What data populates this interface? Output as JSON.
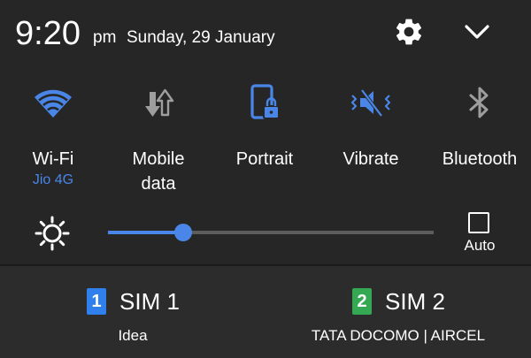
{
  "status": {
    "time": "9:20",
    "ampm": "pm",
    "date": "Sunday, 29 January"
  },
  "header_icons": {
    "settings": "gear-icon",
    "expand": "chevron-down-icon"
  },
  "tiles": [
    {
      "label": "Wi-Fi",
      "sublabel": "Jio 4G",
      "icon": "wifi-icon",
      "active": true
    },
    {
      "label": "Mobile\ndata",
      "icon": "mobile-data-icon",
      "active": false
    },
    {
      "label": "Portrait",
      "icon": "portrait-lock-icon",
      "active": true
    },
    {
      "label": "Vibrate",
      "icon": "vibrate-icon",
      "active": true
    },
    {
      "label": "Bluetooth",
      "icon": "bluetooth-icon",
      "active": false
    }
  ],
  "brightness": {
    "level": 0.23,
    "auto_label": "Auto",
    "auto_checked": false,
    "icon": "brightness-icon"
  },
  "sims": [
    {
      "badge": "1",
      "name": "SIM 1",
      "carrier": "Idea",
      "color": "#2f80ed"
    },
    {
      "badge": "2",
      "name": "SIM 2",
      "carrier": "TATA DOCOMO | AIRCEL",
      "color": "#34a853"
    }
  ],
  "colors": {
    "accent": "#4a86e8",
    "inactive_icon": "#9e9e9e",
    "background": "#262626",
    "sim_panel": "#2c2c2c"
  }
}
